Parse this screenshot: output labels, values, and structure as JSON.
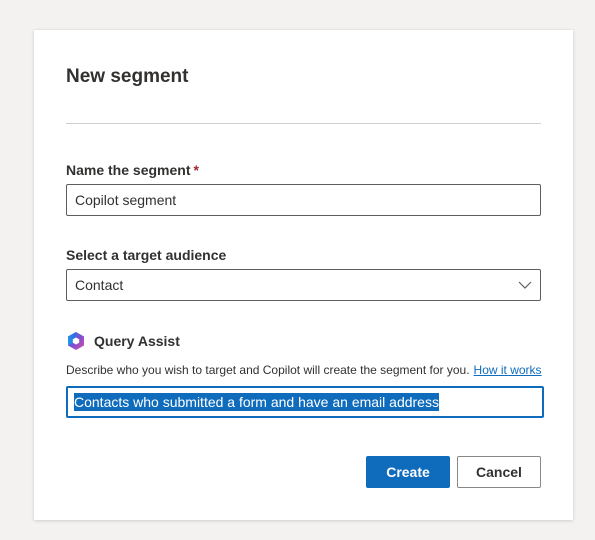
{
  "dialog": {
    "title": "New segment"
  },
  "name_field": {
    "label": "Name the segment",
    "required_marker": "*",
    "value": "Copilot segment"
  },
  "audience_field": {
    "label": "Select a target audience",
    "selected": "Contact"
  },
  "query_assist": {
    "title": "Query Assist",
    "description": "Describe who you wish to target and Copilot will create the segment for you.",
    "link_text": "How it works",
    "input_value": "Contacts who submitted a form and have an email address"
  },
  "actions": {
    "create_label": "Create",
    "cancel_label": "Cancel"
  },
  "colors": {
    "accent": "#0f6cbd",
    "required": "#a4262c"
  }
}
